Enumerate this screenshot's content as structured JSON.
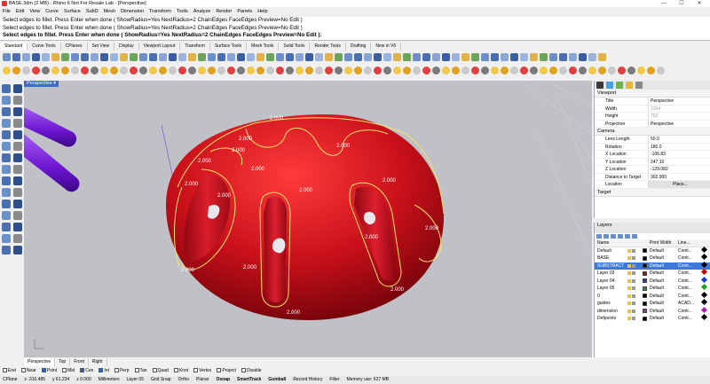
{
  "title": "BASE.3dm (2 MB) - Rhino 6 Not For Resale Lab - [Perspective]",
  "window_controls": [
    "—",
    "☐",
    "✕"
  ],
  "menu": [
    "File",
    "Edit",
    "View",
    "Curve",
    "Surface",
    "SubD",
    "Mesh",
    "Dimension",
    "Transform",
    "Tools",
    "Analyze",
    "Render",
    "Panels",
    "Help"
  ],
  "command": {
    "history": [
      "Select edges to fillet. Press Enter when done ( ShowRadius=Yes  NextRadius=2  ChainEdges  FaceEdges  Preview=No  Edit )",
      "Select edges to fillet. Press Enter when done ( ShowRadius=Yes  NextRadius=2  ChainEdges  FaceEdges  Preview=No  Edit )"
    ],
    "prompt": "Select edges to fillet. Press Enter when done ( ShowRadius=Yes  NextRadius=2  ChainEdges  FaceEdges  Preview=No  Edit ):"
  },
  "toolbar_tabs": [
    "Standard",
    "Curve Tools",
    "CPlanes",
    "Set View",
    "Display",
    "Viewport Layout",
    "Transform",
    "Surface Tools",
    "Mesh Tools",
    "Solid Tools",
    "Render Tools",
    "Drafting",
    "New in V6"
  ],
  "viewport": {
    "name": "Perspective",
    "radius_labels": [
      "2.000",
      "2.000",
      "2.000",
      "2.000",
      "2.000",
      "2.000",
      "2.000",
      "2.000",
      "2.000",
      "2.000",
      "2.000",
      "2.000",
      "2.000",
      "2.000",
      "2.000",
      "2.000"
    ],
    "colors": {
      "object": "#c0101a",
      "edge": "#f5e36a",
      "purple": "#7a22d8"
    }
  },
  "viewport_tabs": [
    "Perspective",
    "Top",
    "Front",
    "Right"
  ],
  "properties": {
    "viewport_section": "Viewport",
    "viewport_rows": [
      {
        "k": "Title",
        "v": "Perspective"
      },
      {
        "k": "Width",
        "v": "1334"
      },
      {
        "k": "Height",
        "v": "752"
      },
      {
        "k": "Projection",
        "v": "Perspective"
      }
    ],
    "camera_section": "Camera",
    "camera_rows": [
      {
        "k": "Lens Length",
        "v": "50.0"
      },
      {
        "k": "Rotation",
        "v": "180.0"
      },
      {
        "k": "X Location",
        "v": "-106.83"
      },
      {
        "k": "Y Location",
        "v": "247.10"
      },
      {
        "k": "Z Location",
        "v": "-129.082"
      },
      {
        "k": "Distance to Target",
        "v": "302.900"
      },
      {
        "k": "Location",
        "v": "Place..."
      }
    ],
    "target_section": "Target"
  },
  "layers": {
    "title": "Layers",
    "columns": [
      "Name",
      "",
      "Print Width",
      "Line..."
    ],
    "rows": [
      {
        "name": "Default",
        "color": "#000000",
        "print": "Default",
        "line": "Conti..."
      },
      {
        "name": "BASE",
        "color": "#000000",
        "print": "Default",
        "line": "Conti..."
      },
      {
        "name": "SUBSTRACT",
        "color": "#000000",
        "print": "Default",
        "line": "Conti...",
        "selected": true
      },
      {
        "name": "Layer 03",
        "color": "#c00000",
        "print": "Default",
        "line": "Conti..."
      },
      {
        "name": "Layer 04",
        "color": "#1c3cd8",
        "print": "Default",
        "line": "Conti..."
      },
      {
        "name": "Layer 05",
        "color": "#20a020",
        "print": "Default",
        "line": "Conti..."
      },
      {
        "name": "0",
        "color": "#000000",
        "print": "Default",
        "line": "Conti..."
      },
      {
        "name": "guides",
        "color": "#000000",
        "print": "Default",
        "line": "ACAD..."
      },
      {
        "name": "dimension",
        "color": "#b020b0",
        "print": "Default",
        "line": "Conti..."
      },
      {
        "name": "Defpoints",
        "color": "#000000",
        "print": "Default",
        "line": "Conti..."
      }
    ]
  },
  "osnaps": [
    {
      "label": "End",
      "on": false
    },
    {
      "label": "Near",
      "on": false
    },
    {
      "label": "Point",
      "on": true
    },
    {
      "label": "Mid",
      "on": false
    },
    {
      "label": "Cen",
      "on": true
    },
    {
      "label": "Int",
      "on": true
    },
    {
      "label": "Perp",
      "on": false
    },
    {
      "label": "Tan",
      "on": false
    },
    {
      "label": "Quad",
      "on": false
    },
    {
      "label": "Knot",
      "on": false
    },
    {
      "label": "Vertex",
      "on": false
    },
    {
      "label": "Project",
      "on": false
    },
    {
      "label": "Disable",
      "on": false
    }
  ],
  "status": [
    "CPlane",
    "x -316.485",
    "y 61.234",
    "z 0.000",
    "Millimeters",
    "Layer 05",
    "Grid Snap",
    "Ortho",
    "Planar",
    "Osnap",
    "SmartTrack",
    "Gumball",
    "Record History",
    "Filter",
    "Memory use: 627 MB"
  ]
}
